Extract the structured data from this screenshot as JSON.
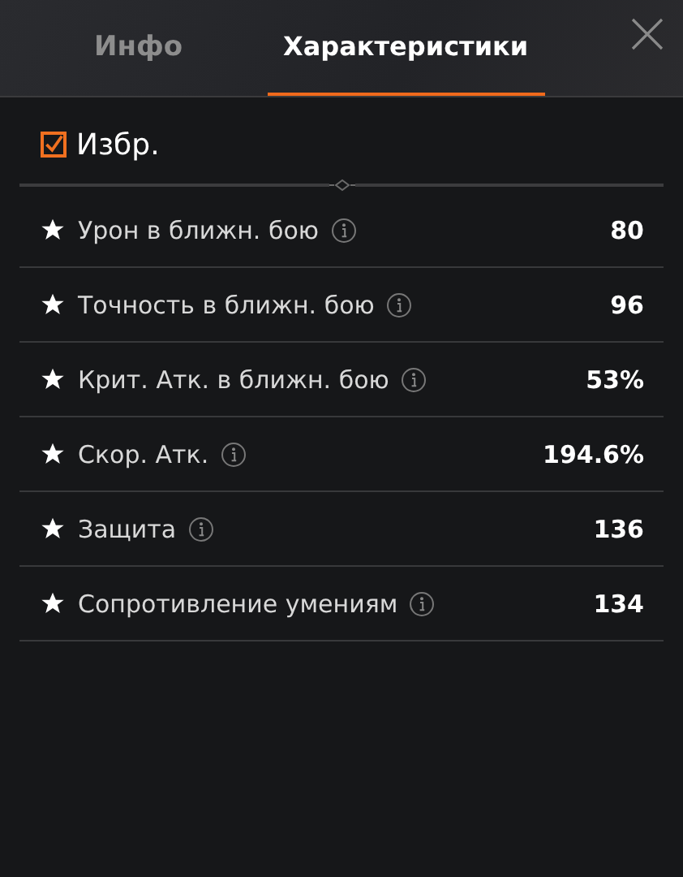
{
  "tabs": [
    {
      "label": "Инфо",
      "selected": false
    },
    {
      "label": "Характеристики",
      "selected": true
    }
  ],
  "favorites_filter": {
    "label": "Избр.",
    "checked": true
  },
  "stats": [
    {
      "name": "Урон в ближн. бою",
      "value": "80",
      "starred": true
    },
    {
      "name": "Точность в ближн. бою",
      "value": "96",
      "starred": true
    },
    {
      "name": "Крит. Атк. в ближн. бою",
      "value": "53%",
      "starred": true
    },
    {
      "name": "Скор. Атк.",
      "value": "194.6%",
      "starred": true
    },
    {
      "name": "Защита",
      "value": "136",
      "starred": true
    },
    {
      "name": "Сопротивление умениям",
      "value": "134",
      "starred": true
    }
  ]
}
